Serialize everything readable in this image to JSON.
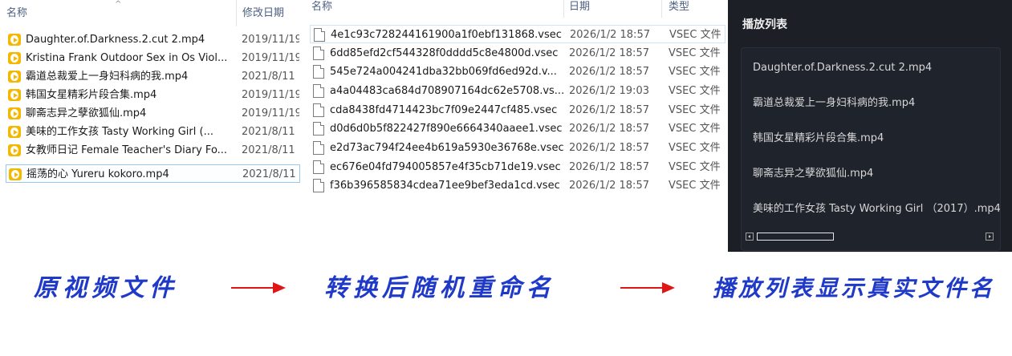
{
  "left_pane": {
    "header": {
      "name": "名称",
      "date": "修改日期"
    },
    "files": [
      {
        "name": "Daughter.of.Darkness.2.cut 2.mp4",
        "date": "2019/11/19"
      },
      {
        "name": "Kristina Frank Outdoor Sex in Os Viol...",
        "date": "2019/11/19"
      },
      {
        "name": "霸道总裁爱上一身妇科病的我.mp4",
        "date": "2021/8/11"
      },
      {
        "name": "韩国女星精彩片段合集.mp4",
        "date": "2019/11/19"
      },
      {
        "name": "聊斋志异之孽欲狐仙.mp4",
        "date": "2019/11/19"
      },
      {
        "name": "美味的工作女孩 Tasty Working Girl (...",
        "date": "2021/8/11"
      },
      {
        "name": "女教师日记 Female Teacher's Diary Fo...",
        "date": "2021/8/11"
      },
      {
        "name": "摇荡的心 Yureru kokoro.mp4",
        "date": "2021/8/11"
      }
    ],
    "icon": "mp4-file-icon"
  },
  "mid_pane": {
    "header": {
      "name": "名称",
      "date": "日期",
      "type": "类型"
    },
    "files": [
      {
        "name": "4e1c93c728244161900a1f0ebf131868.vsec",
        "date": "2026/1/2 18:57",
        "type": "VSEC 文件"
      },
      {
        "name": "6dd85efd2cf544328f0dddd5c8e4800d.vsec",
        "date": "2026/1/2 18:57",
        "type": "VSEC 文件"
      },
      {
        "name": "545e724a004241dba32bb069fd6ed92d.v...",
        "date": "2026/1/2 18:57",
        "type": "VSEC 文件"
      },
      {
        "name": "a4a04483ca684d708907164dc62e5708.vs...",
        "date": "2026/1/2 19:03",
        "type": "VSEC 文件"
      },
      {
        "name": "cda8438fd4714423bc7f09e2447cf485.vsec",
        "date": "2026/1/2 18:57",
        "type": "VSEC 文件"
      },
      {
        "name": "d0d6d0b5f822427f890e6664340aaee1.vsec",
        "date": "2026/1/2 18:57",
        "type": "VSEC 文件"
      },
      {
        "name": "e2d73ac794f24ee4b619a5930e36768e.vsec",
        "date": "2026/1/2 18:57",
        "type": "VSEC 文件"
      },
      {
        "name": "ec676e04fd794005857e4f35cb71de19.vsec",
        "date": "2026/1/2 18:57",
        "type": "VSEC 文件"
      },
      {
        "name": "f36b396585834cdea71ee9bef3eda1cd.vsec",
        "date": "2026/1/2 18:57",
        "type": "VSEC 文件"
      }
    ],
    "icon": "document-file-icon"
  },
  "playlist": {
    "title": "播放列表",
    "items": [
      "Daughter.of.Darkness.2.cut 2.mp4",
      "霸道总裁爱上一身妇科病的我.mp4",
      "韩国女星精彩片段合集.mp4",
      "聊斋志异之孽欲狐仙.mp4",
      "美味的工作女孩 Tasty Working Girl （2017）.mp4"
    ]
  },
  "caption": {
    "step1": "原视频文件",
    "step2": "转换后随机重命名",
    "step3": "播放列表显示真实文件名"
  },
  "colors": {
    "caption_text": "#1f39c8",
    "arrow": "#e01515",
    "playlist_bg": "#1d1f26",
    "mp4_icon": "#f5b800",
    "selection_border": "#99c9ef"
  }
}
